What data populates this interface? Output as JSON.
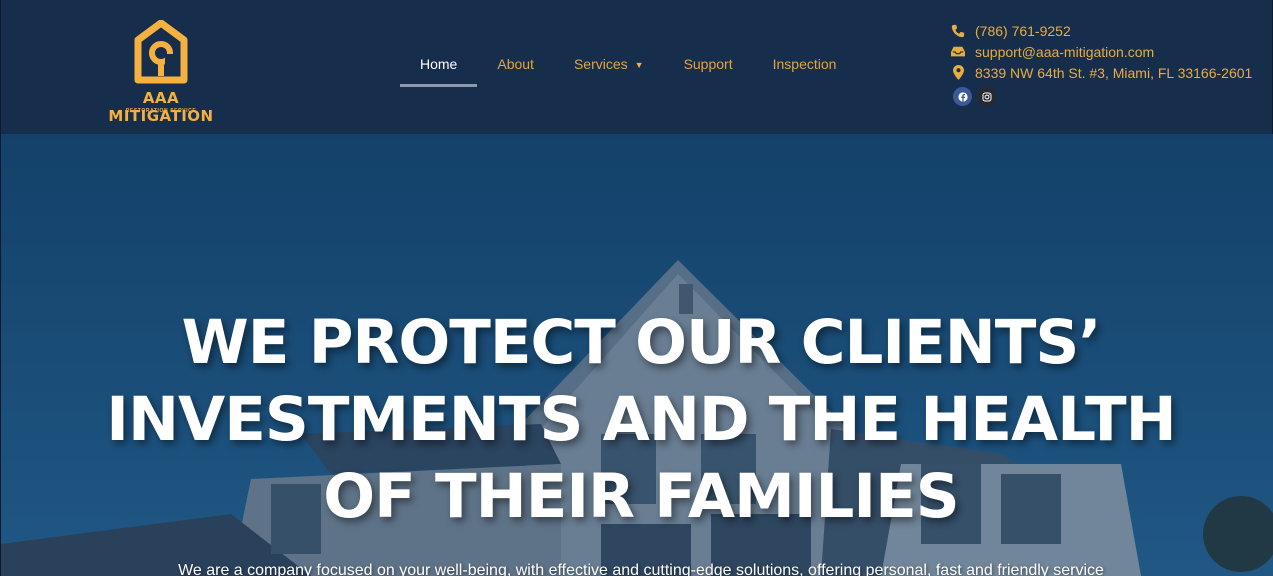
{
  "brand": {
    "name": "AAA MITIGATION",
    "tagline": "RESTORATION SERVICE",
    "color": "#f4b13f"
  },
  "nav": {
    "items": [
      {
        "label": "Home",
        "active": true
      },
      {
        "label": "About"
      },
      {
        "label": "Services",
        "has_dropdown": true,
        "dropdown_icon": "caret-down-icon"
      },
      {
        "label": "Support"
      },
      {
        "label": "Inspection"
      }
    ]
  },
  "contact": {
    "phone": "(786) 761-9252",
    "phone_icon": "phone-icon",
    "email": "support@aaa-mitigation.com",
    "email_icon": "inbox-icon",
    "address": "8339 NW 64th St. #3, Miami, FL 33166-2601",
    "address_icon": "map-marker-icon",
    "social": [
      "facebook-icon",
      "instagram-icon"
    ]
  },
  "hero": {
    "title": "WE PROTECT OUR CLIENTS’ INVESTMENTS AND THE HEALTH OF THEIR FAMILIES",
    "subtitle": "We are a company focused on your well-being, with effective and cutting-edge solutions, offering personal, fast and friendly service"
  },
  "colors": {
    "header_bg": "#172d4c",
    "accent": "#e7ad42",
    "hero_overlay": "#1f5a85"
  }
}
